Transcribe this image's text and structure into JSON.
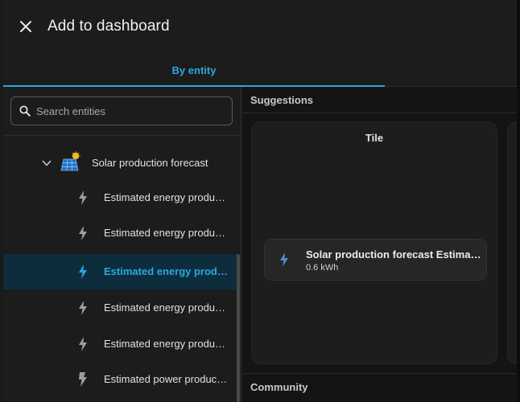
{
  "dialog": {
    "title": "Add to dashboard",
    "close_icon": "close-icon"
  },
  "tabs": [
    {
      "label": "By entity",
      "active": true
    }
  ],
  "search": {
    "placeholder": "Search entities",
    "value": ""
  },
  "tree": {
    "group": {
      "label": "Solar production forecast",
      "icon": "solar-panel-icon",
      "expanded": true
    },
    "entities": [
      {
        "label": "Estimated energy production",
        "icon": "lightning-bolt-icon",
        "selected": false
      },
      {
        "label": "Estimated energy production",
        "icon": "lightning-bolt-icon",
        "selected": false
      },
      {
        "label": "Estimated energy production",
        "icon": "lightning-bolt-icon",
        "selected": true
      },
      {
        "label": "Estimated energy production",
        "icon": "lightning-bolt-icon",
        "selected": false
      },
      {
        "label": "Estimated energy production",
        "icon": "lightning-bolt-icon",
        "selected": false
      },
      {
        "label": "Estimated power production",
        "icon": "flash-icon",
        "selected": false
      }
    ]
  },
  "suggestions": {
    "title": "Suggestions",
    "card": {
      "title": "Tile",
      "tile": {
        "name": "Solar production forecast Estimated energy production",
        "state": "0.6 kWh",
        "icon": "lightning-bolt-icon"
      }
    }
  },
  "community": {
    "title": "Community"
  },
  "colors": {
    "accent": "#2aa8e0",
    "selected_bg": "#0e2d3c",
    "dialog_bg": "#1c1c1c",
    "icon_gray": "#9e9e9e"
  }
}
